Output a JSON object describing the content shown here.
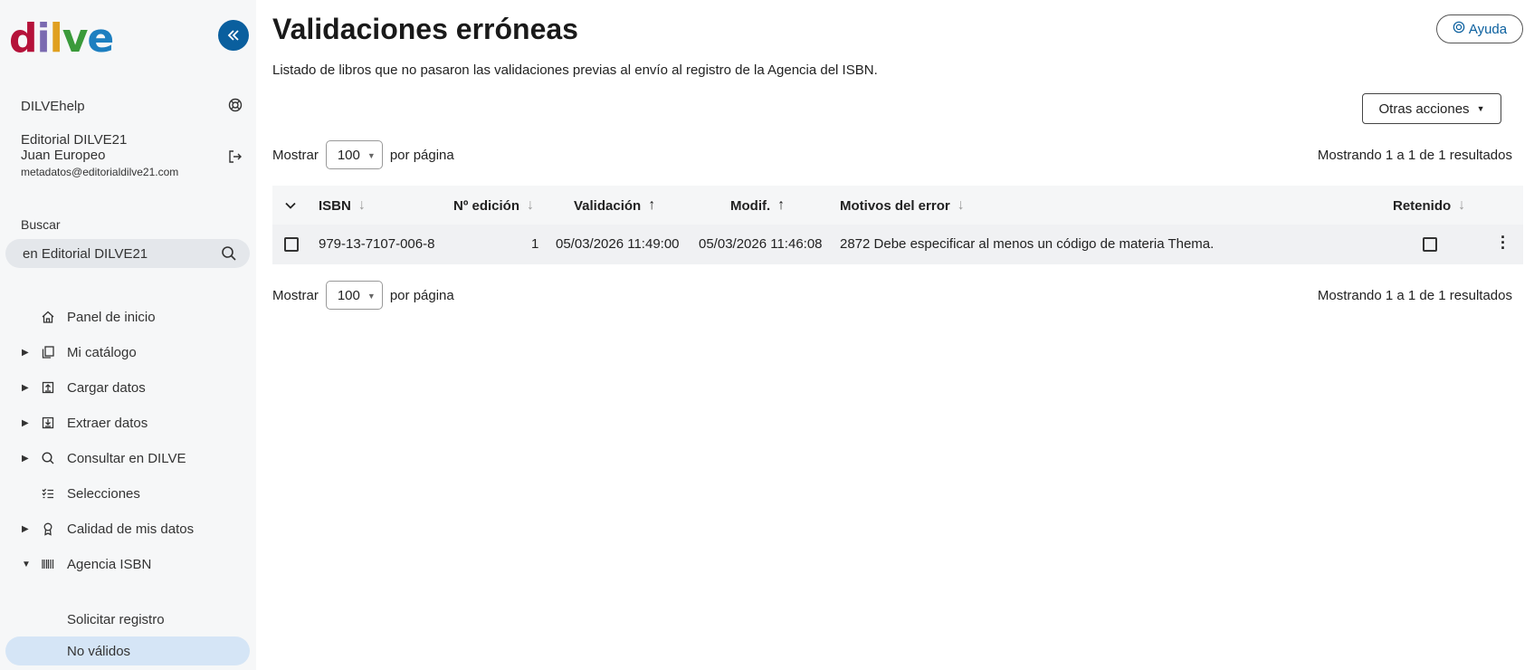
{
  "sidebar": {
    "logo": {
      "d": "d",
      "i": "i",
      "l": "l",
      "v": "v",
      "e": "e"
    },
    "help_site": "DILVEhelp",
    "user": {
      "company": "Editorial DILVE21",
      "name": "Juan Europeo",
      "email": "metadatos@editorialdilve21.com"
    },
    "search": {
      "label": "Buscar",
      "value": "en Editorial DILVE21"
    },
    "nav": [
      {
        "label": "Panel de inicio",
        "icon": "home-icon",
        "expandable": false
      },
      {
        "label": "Mi catálogo",
        "icon": "catalog-icon",
        "expandable": true
      },
      {
        "label": "Cargar datos",
        "icon": "upload-icon",
        "expandable": true
      },
      {
        "label": "Extraer datos",
        "icon": "download-icon",
        "expandable": true
      },
      {
        "label": "Consultar en DILVE",
        "icon": "search-icon",
        "expandable": true
      },
      {
        "label": "Selecciones",
        "icon": "checklist-icon",
        "expandable": false
      },
      {
        "label": "Calidad de mis datos",
        "icon": "award-icon",
        "expandable": true
      },
      {
        "label": "Agencia ISBN",
        "icon": "barcode-icon",
        "expandable": true,
        "expanded": true
      }
    ],
    "subnav": [
      {
        "label": "Solicitar registro",
        "active": false
      },
      {
        "label": "No válidos",
        "active": true
      }
    ]
  },
  "main": {
    "title": "Validaciones erróneas",
    "subtitle": "Listado de libros que no pasaron las validaciones previas al envío al registro de la Agencia del ISBN.",
    "help_label": "Ayuda",
    "actions_label": "Otras acciones",
    "pager": {
      "show": "Mostrar",
      "per_page_value": "100",
      "per_page": "por página",
      "results": "Mostrando 1 a 1 de 1 resultados"
    },
    "table": {
      "columns": [
        "ISBN",
        "Nº edición",
        "Validación",
        "Modif.",
        "Motivos del error",
        "Retenido"
      ],
      "rows": [
        {
          "isbn": "979-13-7107-006-8",
          "edition": "1",
          "validation": "05/03/2026 11:49:00",
          "modified": "05/03/2026 11:46:08",
          "reason": "2872 Debe especificar al menos un código de materia Thema.",
          "retained": false
        }
      ]
    }
  }
}
